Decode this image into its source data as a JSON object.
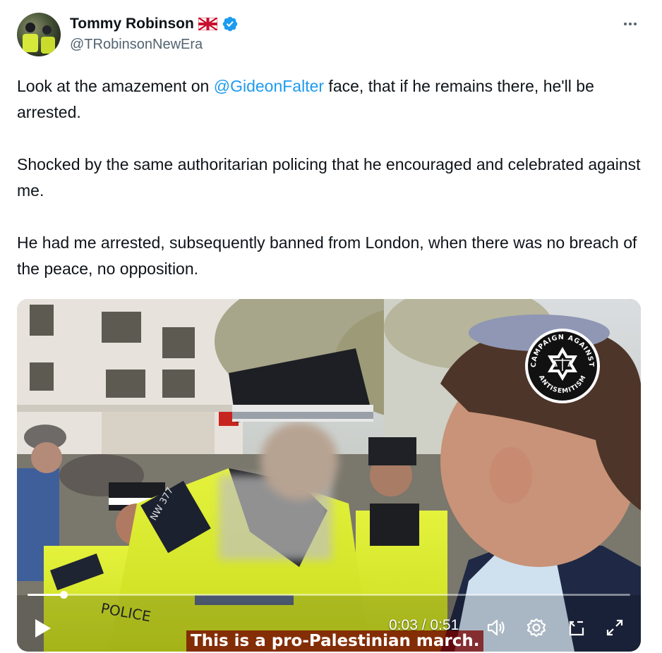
{
  "tweet": {
    "author_name": "Tommy Robinson",
    "handle": "@TRobinsonNewEra",
    "paragraphs": [
      {
        "before": "Look at the amazement on ",
        "mention": "@GideonFalter",
        "after": " face, that if he remains there, he'll be arrested."
      },
      {
        "text": "Shocked by the same authoritarian policing that he encouraged and celebrated against me."
      },
      {
        "text": "He had me arrested, subsequently banned from London, when there was no breach of the peace, no opposition."
      }
    ]
  },
  "media": {
    "caption": "This is a pro-Palestinian march.",
    "time_current": "0:03",
    "time_total": "0:51",
    "progress": 0.06,
    "overlay_logo": {
      "top_text": "CAMPAIGN AGAINST",
      "bottom_text": "ANTISEMITISM"
    },
    "police_text": "POLICE",
    "epaulette_text": "NW 377"
  },
  "icons": {
    "more": "more-horizontal-icon",
    "verified": "verified-badge-icon",
    "flag": "uk-flag-icon",
    "play": "play-icon",
    "volume": "volume-icon",
    "settings": "gear-icon",
    "pip": "picture-in-picture-icon",
    "fullscreen": "fullscreen-icon"
  },
  "colors": {
    "link": "#1d9bf0",
    "verified": "#1d9bf0",
    "text": "#0f1419",
    "secondary": "#536471"
  }
}
